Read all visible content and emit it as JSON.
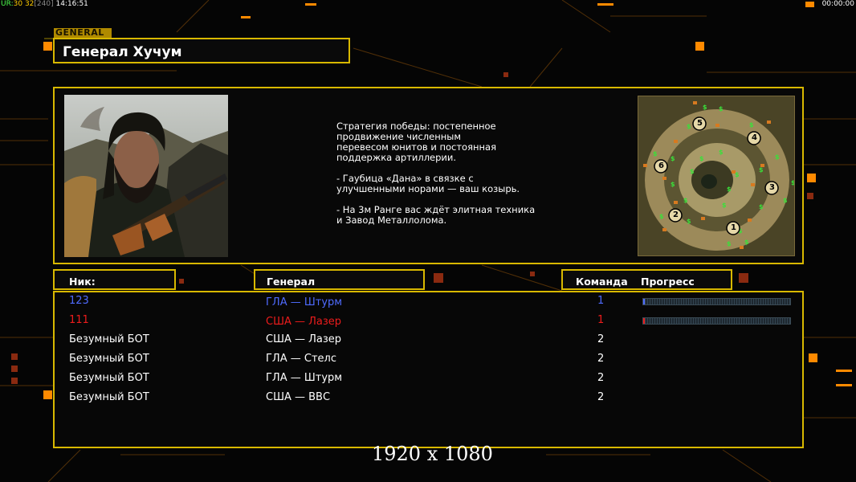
{
  "hud": {
    "fps_label": "UR:",
    "fps_value": "30",
    "fps_value2": "32",
    "fps_bracket": "[240]",
    "time": "14:16:51",
    "timer": "00:00:00"
  },
  "general_tag": "GENERAL",
  "general_name": "Генерал Хучум",
  "description": {
    "line1": "Стратегия победы: постепенное",
    "line2": "продвижение численным",
    "line3": "перевесом юнитов и постоянная",
    "line4": "поддержка артиллерии.",
    "line5": "- Гаубица «Дана» в связке с",
    "line6": "улучшенными норами — ваш козырь.",
    "line7": "- На 3м Ранге вас ждёт элитная техника",
    "line8": "и Завод Металлолома."
  },
  "minimap": {
    "start_positions": [
      "1",
      "2",
      "3",
      "4",
      "5",
      "6"
    ]
  },
  "columns": {
    "nick": "Ник:",
    "general": "Генерал",
    "team": "Команда",
    "progress": "Прогресс"
  },
  "players": [
    {
      "nick": "123",
      "general": "ГЛА — Штурм",
      "team": "1",
      "color": "#4f6bff",
      "progress": 0.01
    },
    {
      "nick": "111",
      "general": "США — Лазер",
      "team": "1",
      "color": "#ee1c1c",
      "progress": 0.01
    },
    {
      "nick": "Безумный БОТ",
      "general": "США — Лазер",
      "team": "2",
      "color": "#ffffff"
    },
    {
      "nick": "Безумный БОТ",
      "general": "ГЛА — Стелс",
      "team": "2",
      "color": "#ffffff"
    },
    {
      "nick": "Безумный БОТ",
      "general": "ГЛА — Штурм",
      "team": "2",
      "color": "#ffffff"
    },
    {
      "nick": "Безумный БОТ",
      "general": "США — ВВС",
      "team": "2",
      "color": "#ffffff"
    }
  ],
  "resolution": "1920 x 1080",
  "colors": {
    "accent": "#d8b800",
    "orange": "#ff8a00",
    "player_blue": "#4f6bff",
    "player_red": "#ee1c1c"
  }
}
